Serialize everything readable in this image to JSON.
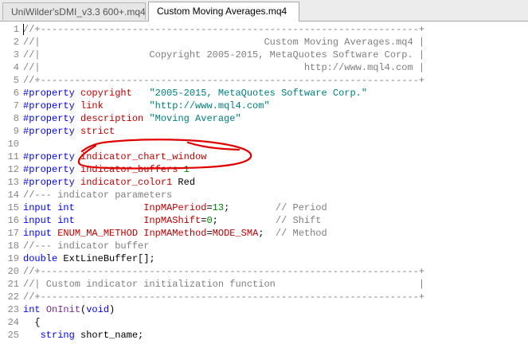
{
  "tabs": [
    {
      "label": "UniWilder'sDMI_v3.3 600+.mq4",
      "active": false
    },
    {
      "label": "Custom Moving Averages.mq4",
      "active": true
    }
  ],
  "lines": [
    {
      "n": "1",
      "parts": [
        [
          "cmt",
          "//+------------------------------------------------------------------+"
        ]
      ]
    },
    {
      "n": "2",
      "parts": [
        [
          "cmt",
          "//|                                       Custom Moving Averages.mq4 |"
        ]
      ]
    },
    {
      "n": "3",
      "parts": [
        [
          "cmt",
          "//|                   Copyright 2005-2015, MetaQuotes Software Corp. |"
        ]
      ]
    },
    {
      "n": "4",
      "parts": [
        [
          "cmt",
          "//|                                              http://www.mql4.com |"
        ]
      ]
    },
    {
      "n": "5",
      "parts": [
        [
          "cmt",
          "//+------------------------------------------------------------------+"
        ]
      ]
    },
    {
      "n": "6",
      "parts": [
        [
          "kw",
          "#property "
        ],
        [
          "red",
          "copyright"
        ],
        [
          "dark",
          "   "
        ],
        [
          "str",
          "\"2005-2015, MetaQuotes Software Corp.\""
        ]
      ]
    },
    {
      "n": "7",
      "parts": [
        [
          "kw",
          "#property "
        ],
        [
          "red",
          "link"
        ],
        [
          "dark",
          "        "
        ],
        [
          "str",
          "\"http://www.mql4.com\""
        ]
      ]
    },
    {
      "n": "8",
      "parts": [
        [
          "kw",
          "#property "
        ],
        [
          "red",
          "description"
        ],
        [
          "dark",
          " "
        ],
        [
          "str",
          "\"Moving Average\""
        ]
      ]
    },
    {
      "n": "9",
      "parts": [
        [
          "kw",
          "#property "
        ],
        [
          "red",
          "strict"
        ]
      ]
    },
    {
      "n": "10",
      "parts": []
    },
    {
      "n": "11",
      "parts": [
        [
          "kw",
          "#property "
        ],
        [
          "red",
          "indicator_chart_window"
        ]
      ]
    },
    {
      "n": "12",
      "parts": [
        [
          "kw",
          "#property "
        ],
        [
          "red",
          "indicator_buffers"
        ],
        [
          "dark",
          " "
        ],
        [
          "num",
          "1"
        ]
      ]
    },
    {
      "n": "13",
      "parts": [
        [
          "kw",
          "#property "
        ],
        [
          "red",
          "indicator_color1"
        ],
        [
          "dark",
          " Red"
        ]
      ]
    },
    {
      "n": "14",
      "parts": [
        [
          "cmt",
          "//--- indicator parameters"
        ]
      ]
    },
    {
      "n": "15",
      "parts": [
        [
          "kw",
          "input int"
        ],
        [
          "dark",
          "            "
        ],
        [
          "red",
          "InpMAPeriod"
        ],
        [
          "dark",
          "="
        ],
        [
          "num",
          "13"
        ],
        [
          "dark",
          ";        "
        ],
        [
          "cmt",
          "// Period"
        ]
      ]
    },
    {
      "n": "16",
      "parts": [
        [
          "kw",
          "input int"
        ],
        [
          "dark",
          "            "
        ],
        [
          "red",
          "InpMAShift"
        ],
        [
          "dark",
          "="
        ],
        [
          "num",
          "0"
        ],
        [
          "dark",
          ";          "
        ],
        [
          "cmt",
          "// Shift"
        ]
      ]
    },
    {
      "n": "17",
      "parts": [
        [
          "kw",
          "input "
        ],
        [
          "red",
          "ENUM_MA_METHOD"
        ],
        [
          "dark",
          " "
        ],
        [
          "red",
          "InpMAMethod"
        ],
        [
          "dark",
          "="
        ],
        [
          "red",
          "MODE_SMA"
        ],
        [
          "dark",
          ";  "
        ],
        [
          "cmt",
          "// Method"
        ]
      ]
    },
    {
      "n": "18",
      "parts": [
        [
          "cmt",
          "//--- indicator buffer"
        ]
      ]
    },
    {
      "n": "19",
      "parts": [
        [
          "kw",
          "double"
        ],
        [
          "dark",
          " ExtLineBuffer[];"
        ]
      ]
    },
    {
      "n": "20",
      "parts": [
        [
          "cmt",
          "//+------------------------------------------------------------------+"
        ]
      ]
    },
    {
      "n": "21",
      "parts": [
        [
          "cmt",
          "//| Custom indicator initialization function                         |"
        ]
      ]
    },
    {
      "n": "22",
      "parts": [
        [
          "cmt",
          "//+------------------------------------------------------------------+"
        ]
      ]
    },
    {
      "n": "23",
      "parts": [
        [
          "kw",
          "int"
        ],
        [
          "dark",
          " "
        ],
        [
          "fn",
          "OnInit"
        ],
        [
          "dark",
          "("
        ],
        [
          "kw",
          "void"
        ],
        [
          "dark",
          ")"
        ]
      ]
    },
    {
      "n": "24",
      "parts": [
        [
          "dark",
          "  {"
        ]
      ]
    },
    {
      "n": "25",
      "parts": [
        [
          "dark",
          "   "
        ],
        [
          "kw",
          "string"
        ],
        [
          "dark",
          " short_name;"
        ]
      ]
    }
  ]
}
